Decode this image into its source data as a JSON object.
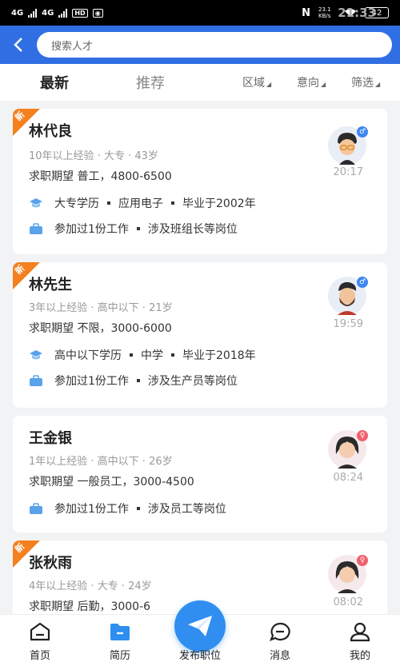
{
  "status_bar": {
    "time": "21:33",
    "net1": "4G",
    "net2": "4G",
    "hd": "HD",
    "speed": "23.1 KB/s",
    "battery": "42"
  },
  "search": {
    "placeholder": "搜索人才"
  },
  "tabs": [
    {
      "label": "最新",
      "active": true
    },
    {
      "label": "推荐",
      "active": false
    }
  ],
  "filters": [
    {
      "label": "区域"
    },
    {
      "label": "意向"
    },
    {
      "label": "筛选"
    }
  ],
  "cards": [
    {
      "badge": "新",
      "name": "林代良",
      "meta": "10年以上经验 · 大专 · 43岁",
      "expect": "求职期望 普工，4800-6500",
      "edu": {
        "a": "大专学历",
        "b": "应用电子",
        "c": "毕业于2002年"
      },
      "work": {
        "a": "参加过1份工作",
        "b": "涉及班组长等岗位"
      },
      "time": "20:17",
      "gender": "male"
    },
    {
      "badge": "新",
      "name": "林先生",
      "meta": "3年以上经验 · 高中以下 · 21岁",
      "expect": "求职期望 不限，3000-6000",
      "edu": {
        "a": "高中以下学历",
        "b": "中学",
        "c": "毕业于2018年"
      },
      "work": {
        "a": "参加过1份工作",
        "b": "涉及生产员等岗位"
      },
      "time": "19:59",
      "gender": "male"
    },
    {
      "badge": "",
      "name": "王金银",
      "meta": "1年以上经验 · 高中以下 · 26岁",
      "expect": "求职期望 一般员工，3000-4500",
      "work": {
        "a": "参加过1份工作",
        "b": "涉及员工等岗位"
      },
      "time": "08:24",
      "gender": "female"
    },
    {
      "badge": "新",
      "name": "张秋雨",
      "meta": "4年以上经验 · 大专 · 24岁",
      "expect": "求职期望 后勤，3000-6",
      "time": "08:02",
      "gender": "female"
    }
  ],
  "nav": [
    {
      "label": "首页"
    },
    {
      "label": "简历"
    },
    {
      "label": "发布职位"
    },
    {
      "label": "消息"
    },
    {
      "label": "我的"
    }
  ],
  "colors": {
    "primary": "#2f6fe3",
    "badge": "#f4801f",
    "post_button": "#2f8ef0"
  }
}
